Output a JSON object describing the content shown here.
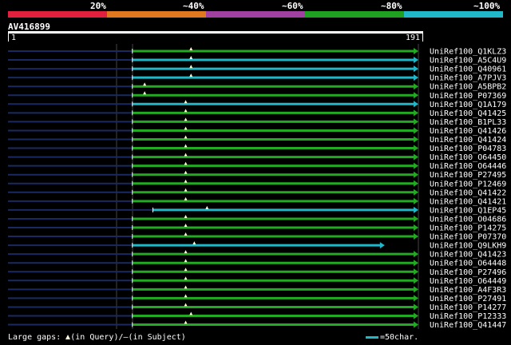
{
  "legend": {
    "segments": [
      {
        "color": "#e0203c"
      },
      {
        "color": "#e07820"
      },
      {
        "color": "#a040a0"
      },
      {
        "color": "#20a020"
      },
      {
        "color": "#20b8c8"
      }
    ],
    "labels": [
      "20%",
      "~40%",
      "~60%",
      "~80%",
      "~100%"
    ]
  },
  "query": {
    "id": "AV416899",
    "start": "1",
    "end": "191"
  },
  "colors": {
    "green": "#22aa22",
    "cyan": "#20b8c8",
    "navy": "#1a2a60",
    "marker": "#ffffd0"
  },
  "hits": [
    {
      "name": "UniRef100_Q1KLZ3",
      "color": "green",
      "start": 0.303,
      "end": 1.0,
      "marker": 0.446
    },
    {
      "name": "UniRef100_A5C4U9",
      "color": "cyan",
      "start": 0.303,
      "end": 1.0,
      "marker": 0.446
    },
    {
      "name": "UniRef100_Q40961",
      "color": "cyan",
      "start": 0.303,
      "end": 1.0,
      "marker": 0.446
    },
    {
      "name": "UniRef100_A7PJV3",
      "color": "cyan",
      "start": 0.303,
      "end": 1.0,
      "marker": 0.446
    },
    {
      "name": "UniRef100_A5BPB2",
      "color": "green",
      "start": 0.303,
      "end": 1.0,
      "marker": 0.333
    },
    {
      "name": "UniRef100_P07369",
      "color": "green",
      "start": 0.303,
      "end": 1.0,
      "marker": 0.333
    },
    {
      "name": "UniRef100_Q1A179",
      "color": "cyan",
      "start": 0.303,
      "end": 1.0,
      "marker": 0.433
    },
    {
      "name": "UniRef100_Q41425",
      "color": "green",
      "start": 0.303,
      "end": 1.0,
      "marker": 0.433
    },
    {
      "name": "UniRef100_B1PL33",
      "color": "green",
      "start": 0.303,
      "end": 1.0,
      "marker": 0.433
    },
    {
      "name": "UniRef100_Q41426",
      "color": "green",
      "start": 0.303,
      "end": 1.0,
      "marker": 0.433
    },
    {
      "name": "UniRef100_Q41424",
      "color": "green",
      "start": 0.303,
      "end": 1.0,
      "marker": 0.433
    },
    {
      "name": "UniRef100_P04783",
      "color": "green",
      "start": 0.303,
      "end": 1.0,
      "marker": 0.433
    },
    {
      "name": "UniRef100_O64450",
      "color": "green",
      "start": 0.303,
      "end": 1.0,
      "marker": 0.433
    },
    {
      "name": "UniRef100_O64446",
      "color": "green",
      "start": 0.303,
      "end": 1.0,
      "marker": 0.433
    },
    {
      "name": "UniRef100_P27495",
      "color": "green",
      "start": 0.303,
      "end": 1.0,
      "marker": 0.433
    },
    {
      "name": "UniRef100_P12469",
      "color": "green",
      "start": 0.303,
      "end": 1.0,
      "marker": 0.433
    },
    {
      "name": "UniRef100_Q41422",
      "color": "green",
      "start": 0.303,
      "end": 1.0,
      "marker": 0.433
    },
    {
      "name": "UniRef100_Q41421",
      "color": "green",
      "start": 0.303,
      "end": 1.0,
      "marker": 0.433
    },
    {
      "name": "UniRef100_Q1EP45",
      "color": "cyan",
      "start": 0.353,
      "end": 1.0,
      "marker": 0.485
    },
    {
      "name": "UniRef100_O04686",
      "color": "green",
      "start": 0.303,
      "end": 1.0,
      "marker": 0.433
    },
    {
      "name": "UniRef100_P14275",
      "color": "green",
      "start": 0.303,
      "end": 1.0,
      "marker": 0.433
    },
    {
      "name": "UniRef100_P07370",
      "color": "green",
      "start": 0.303,
      "end": 1.0,
      "marker": 0.433
    },
    {
      "name": "UniRef100_Q9LKH9",
      "color": "cyan",
      "start": 0.303,
      "end": 0.918,
      "marker": 0.454
    },
    {
      "name": "UniRef100_Q41423",
      "color": "green",
      "start": 0.303,
      "end": 1.0,
      "marker": 0.433
    },
    {
      "name": "UniRef100_O64448",
      "color": "green",
      "start": 0.303,
      "end": 1.0,
      "marker": 0.433
    },
    {
      "name": "UniRef100_P27496",
      "color": "green",
      "start": 0.303,
      "end": 1.0,
      "marker": 0.433
    },
    {
      "name": "UniRef100_O64449",
      "color": "green",
      "start": 0.303,
      "end": 1.0,
      "marker": 0.433
    },
    {
      "name": "UniRef100_A4F3R3",
      "color": "green",
      "start": 0.303,
      "end": 1.0,
      "marker": 0.433
    },
    {
      "name": "UniRef100_P27491",
      "color": "green",
      "start": 0.303,
      "end": 1.0,
      "marker": 0.433
    },
    {
      "name": "UniRef100_P14277",
      "color": "green",
      "start": 0.303,
      "end": 1.0,
      "marker": 0.433
    },
    {
      "name": "UniRef100_P12333",
      "color": "green",
      "start": 0.303,
      "end": 1.0,
      "marker": 0.446
    },
    {
      "name": "UniRef100_Q41447",
      "color": "green",
      "start": 0.303,
      "end": 1.0,
      "marker": 0.433
    }
  ],
  "footer": {
    "prefix": "Large gaps:",
    "query_text": "(in Query)/",
    "dash": "–",
    "subject_text": "(in Subject)",
    "scale_text": "=50char."
  }
}
